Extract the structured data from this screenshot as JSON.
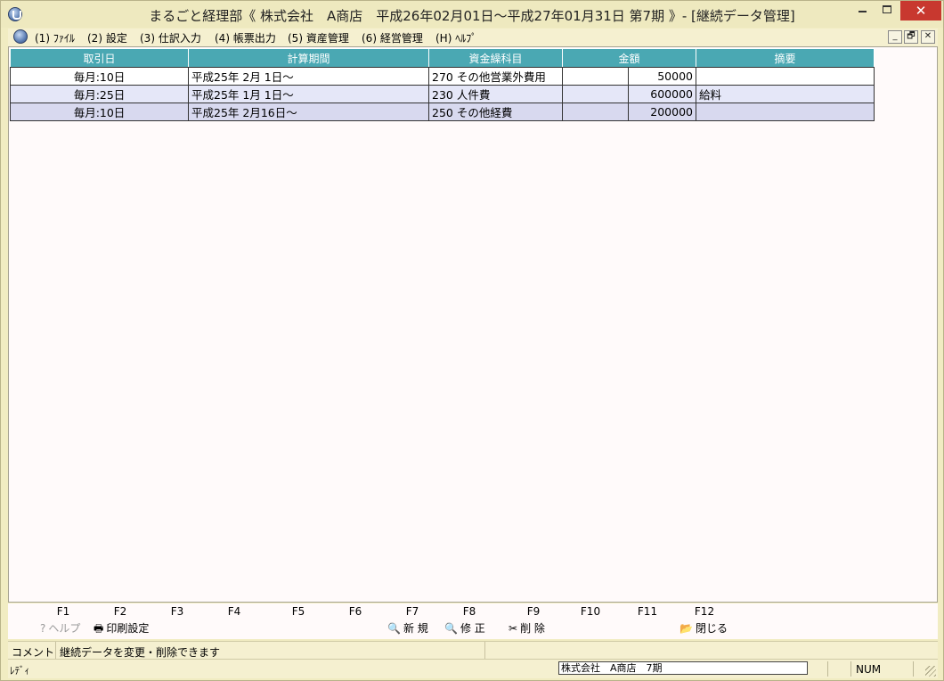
{
  "window": {
    "title": "まるごと経理部《 株式会社　A商店　平成26年02月01日～平成27年01月31日 第7期 》- [継続データ管理]",
    "minimize": "_",
    "maximize": "□",
    "close": "✕"
  },
  "menu": {
    "items": [
      {
        "label": "(1) ﾌｧｲﾙ"
      },
      {
        "label": "(2) 設定"
      },
      {
        "label": "(3) 仕訳入力"
      },
      {
        "label": "(4) 帳票出力"
      },
      {
        "label": "(5) 資産管理"
      },
      {
        "label": "(6) 経営管理"
      },
      {
        "label": "(H) ﾍﾙﾌﾟ"
      }
    ],
    "mdi_buttons": [
      "_",
      "🗗",
      "✕"
    ]
  },
  "table": {
    "headers": [
      "取引日",
      "計算期間",
      "資金繰科目",
      "金額",
      "摘要"
    ],
    "rows": [
      {
        "date": "毎月:10日",
        "period": "平成25年 2月 1日～",
        "account": "270 その他営業外費用",
        "amount": "50000",
        "memo": ""
      },
      {
        "date": "毎月:25日",
        "period": "平成25年 1月 1日～",
        "account": "230 人件費",
        "amount": "600000",
        "memo": "給料"
      },
      {
        "date": "毎月:10日",
        "period": "平成25年 2月16日～",
        "account": "250 その他経費",
        "amount": "200000",
        "memo": ""
      }
    ]
  },
  "fkeys": {
    "keys": [
      "F1",
      "F2",
      "F3",
      "F4",
      "F5",
      "F6",
      "F7",
      "F8",
      "F9",
      "F10",
      "F11",
      "F12"
    ],
    "f1_label": "ヘルプ",
    "f2_label": "印刷設定",
    "f7_label": "新 規",
    "f8_label": "修 正",
    "f9_label": "削 除",
    "f12_label": "閉じる"
  },
  "comment": {
    "label": "コメント",
    "text": "継続データを変更・削除できます"
  },
  "status": {
    "ready": "ﾚﾃﾞｨ",
    "company": "株式会社　A商店　7期",
    "num": "NUM"
  }
}
